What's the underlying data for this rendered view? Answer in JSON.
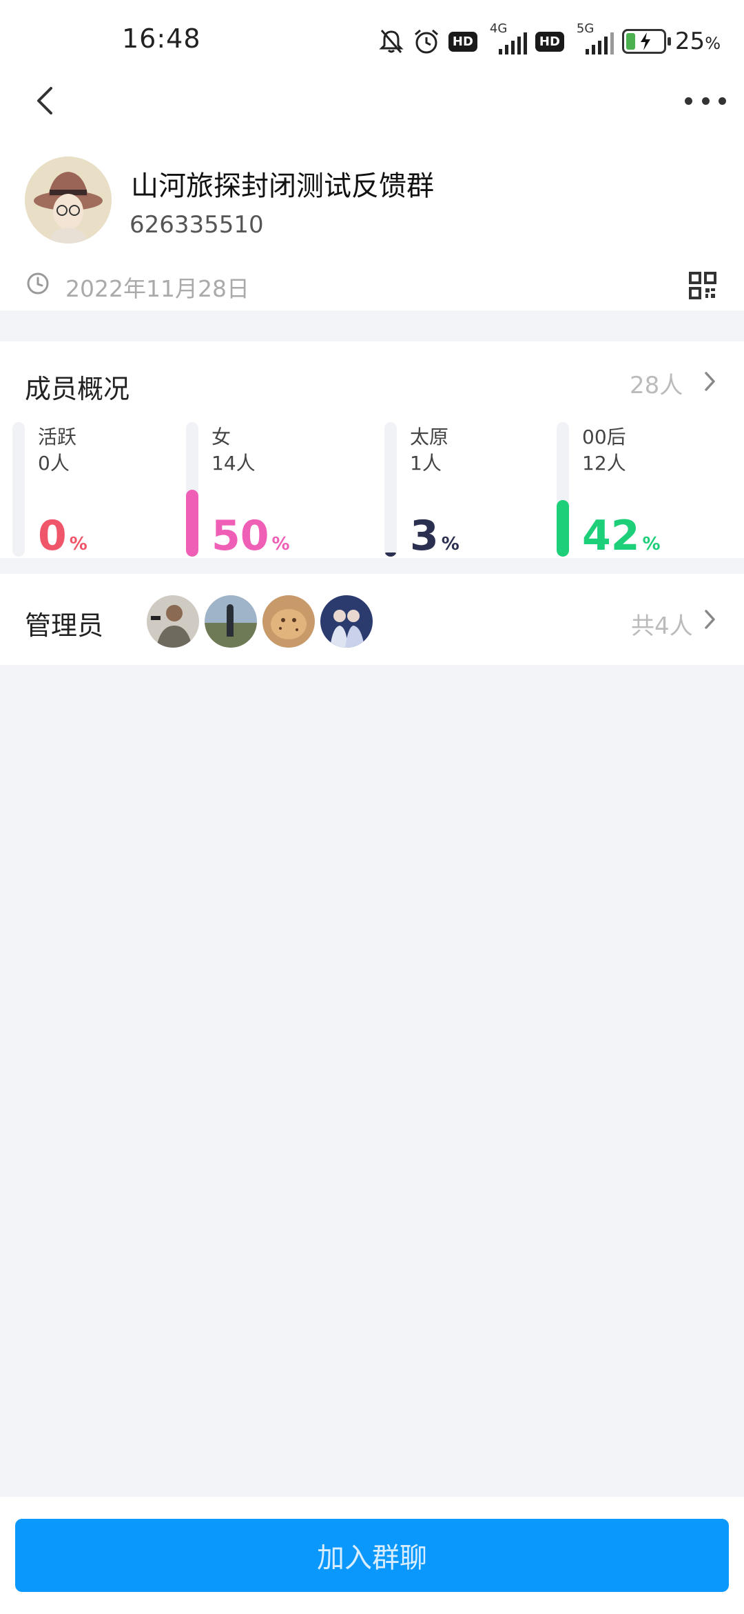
{
  "status_bar": {
    "time": "16:48",
    "net1": "4G",
    "net2": "5G",
    "hd": "HD",
    "battery_percent": 25,
    "battery_text": "25",
    "battery_unit": "%"
  },
  "header": {
    "back_icon": "chevron-left-icon",
    "more_icon": "more-dots-icon"
  },
  "group": {
    "name": "山河旅探封闭测试反馈群",
    "id": "626335510",
    "created_date": "2022年11月28日",
    "qr_icon": "qr-code-icon"
  },
  "members": {
    "title": "成员概况",
    "count": "28人",
    "stats": [
      {
        "label": "活跃",
        "sub": "0人",
        "percent": 0,
        "pct_text": "0",
        "color": "#f0566a"
      },
      {
        "label": "女",
        "sub": "14人",
        "percent": 50,
        "pct_text": "50",
        "color": "#ef5fb6"
      },
      {
        "label": "太原",
        "sub": "1人",
        "percent": 3,
        "pct_text": "3",
        "color": "#2c3050"
      },
      {
        "label": "00后",
        "sub": "12人",
        "percent": 42,
        "pct_text": "42",
        "color": "#1ecf7a"
      }
    ],
    "pct_sign": "%"
  },
  "admins": {
    "title": "管理员",
    "count": "共4人",
    "avatar_count": 4
  },
  "join_button": "加入群聊"
}
